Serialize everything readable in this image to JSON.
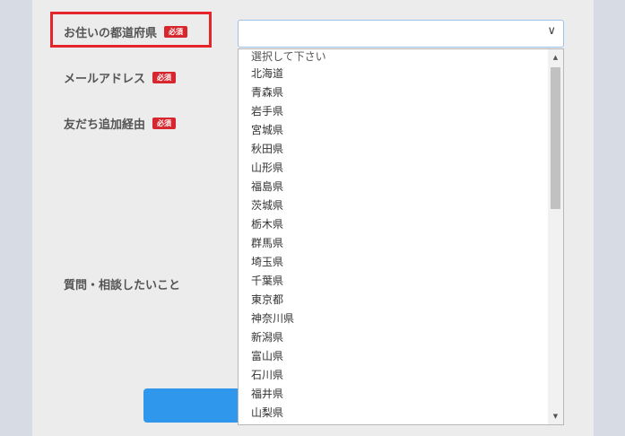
{
  "form": {
    "prefecture_label": "お住いの都道府県",
    "email_label": "メールアドレス",
    "referral_label": "友だち追加経由",
    "question_label": "質問・相談したいこと",
    "required_badge": "必須",
    "prefecture_value": ""
  },
  "dropdown": {
    "options": [
      "選択して下さい",
      "北海道",
      "青森県",
      "岩手県",
      "宮城県",
      "秋田県",
      "山形県",
      "福島県",
      "茨城県",
      "栃木県",
      "群馬県",
      "埼玉県",
      "千葉県",
      "東京都",
      "神奈川県",
      "新潟県",
      "富山県",
      "石川県",
      "福井県",
      "山梨県"
    ]
  },
  "icons": {
    "select_arrow": "chevron-down-icon",
    "scroll_up": "scroll-up-arrow-icon",
    "scroll_down": "scroll-down-arrow-icon"
  },
  "colors": {
    "required_badge": "#d8262e",
    "highlight_border": "#e4262c",
    "submit_button": "#2f97ec",
    "panel_background": "#ececec",
    "page_background": "#d7dce4"
  }
}
